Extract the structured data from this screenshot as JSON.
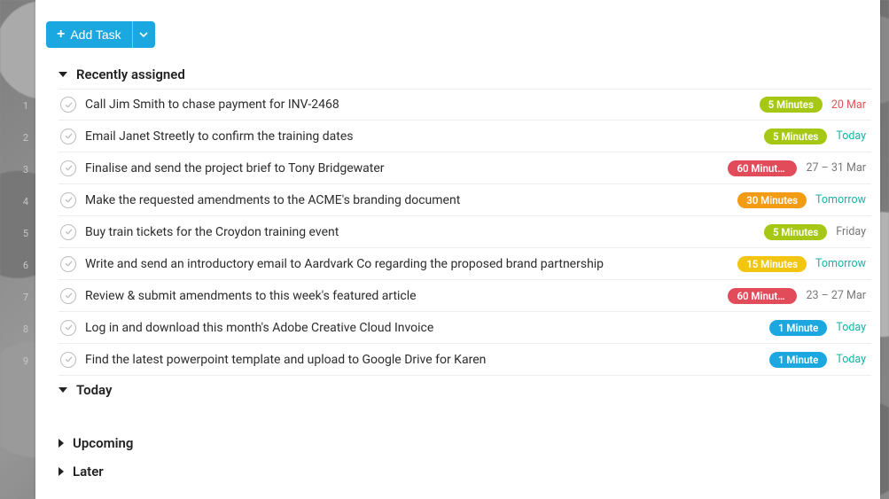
{
  "addTask": {
    "label": "Add Task"
  },
  "lineNumbers": [
    "1",
    "2",
    "3",
    "4",
    "5",
    "6",
    "7",
    "8",
    "9"
  ],
  "sections": {
    "recently": {
      "title": "Recently assigned",
      "expanded": true
    },
    "today": {
      "title": "Today",
      "expanded": true
    },
    "upcoming": {
      "title": "Upcoming",
      "expanded": false
    },
    "later": {
      "title": "Later",
      "expanded": false
    }
  },
  "badgeColors": {
    "lime": "#a6c814",
    "red": "#e14b5a",
    "orange": "#f39b13",
    "yellow": "#f2c511",
    "blue": "#1ba8e0"
  },
  "tasks": [
    {
      "title_html": "Call Jim Smith to chase payment for <span class='spell'>INV</span>-2468",
      "title_plain": "Call Jim Smith to chase payment for INV-2468",
      "duration": "5 Minutes",
      "duration_color": "lime",
      "date": "20 Mar",
      "date_class": "overdue"
    },
    {
      "title_html": "Email Janet Streetly to confirm the training dates",
      "title_plain": "Email Janet Streetly to confirm the training dates",
      "duration": "5 Minutes",
      "duration_color": "lime",
      "date": "Today",
      "date_class": "today"
    },
    {
      "title_html": "Finalise and send the project brief to Tony <span class='spell'>Bridgewater</span>",
      "title_plain": "Finalise and send the project brief to Tony Bridgewater",
      "duration": "60 Minute...",
      "duration_color": "red",
      "date": "27 – 31 Mar",
      "date_class": "future"
    },
    {
      "title_html": "Make the requested amendments to the ACME's branding document",
      "title_plain": "Make the requested amendments to the ACME's branding document",
      "duration": "30 Minutes",
      "duration_color": "orange",
      "date": "Tomorrow",
      "date_class": "today"
    },
    {
      "title_html": "Buy train tickets for the <span class='spell'>Croydon</span> training event",
      "title_plain": "Buy train tickets for the Croydon training event",
      "duration": "5 Minutes",
      "duration_color": "lime",
      "date": "Friday",
      "date_class": "future"
    },
    {
      "title_html": "Write and send an introductory email to Aardvark Co regarding the proposed brand partnership",
      "title_plain": "Write and send an introductory email to Aardvark Co regarding the proposed brand partnership",
      "duration": "15 Minutes",
      "duration_color": "yellow",
      "date": "Tomorrow",
      "date_class": "today"
    },
    {
      "title_html": "Review & submit amendments to this week's featured article",
      "title_plain": "Review & submit amendments to this week's featured article",
      "duration": "60 Minute...",
      "duration_color": "red",
      "date": "23 – 27 Mar",
      "date_class": "future"
    },
    {
      "title_html": "Log in and download this month's Adobe Creative Cloud Invoice",
      "title_plain": "Log in and download this month's Adobe Creative Cloud Invoice",
      "duration": "1 Minute",
      "duration_color": "blue",
      "date": "Today",
      "date_class": "today"
    },
    {
      "title_html": "Find the latest <span class='spell'>powerpoint</span> template and upload to Google Drive for Karen",
      "title_plain": "Find the latest powerpoint template and upload to Google Drive for Karen",
      "duration": "1 Minute",
      "duration_color": "blue",
      "date": "Today",
      "date_class": "today"
    }
  ]
}
